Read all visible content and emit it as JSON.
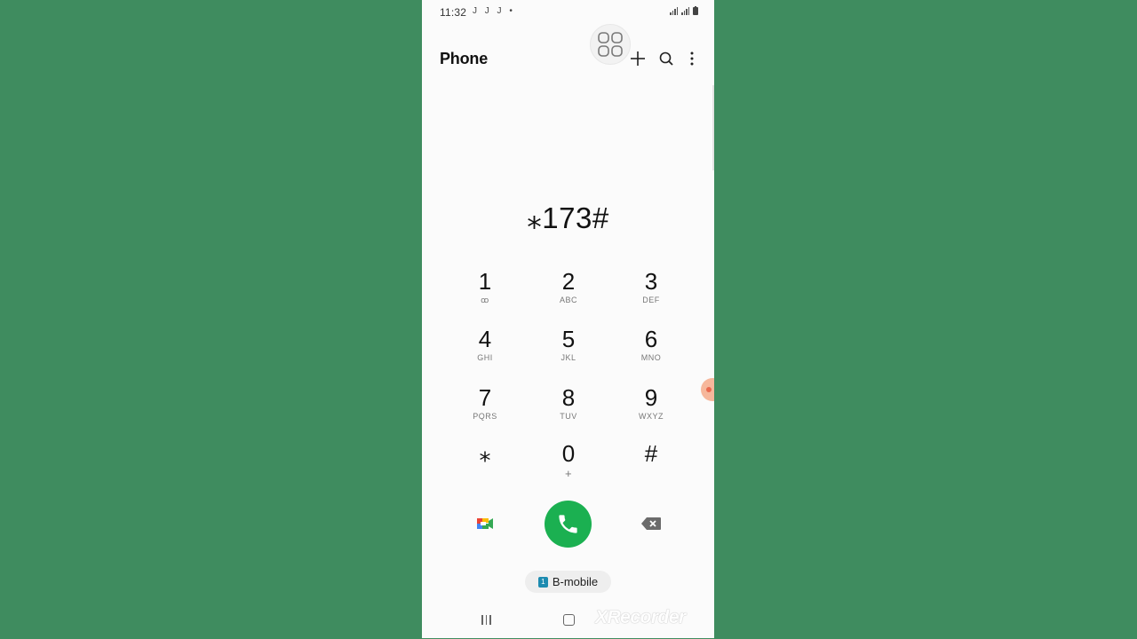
{
  "status_bar": {
    "time": "11:32",
    "notif_icons": "J J J •"
  },
  "header": {
    "title": "Phone",
    "icons": [
      "apps-grid-icon",
      "plus-icon",
      "search-icon",
      "more-vertical-icon"
    ]
  },
  "dialer": {
    "number": "⁎173#",
    "keys": [
      {
        "digit": "1",
        "letters": "ꝏ"
      },
      {
        "digit": "2",
        "letters": "ABC"
      },
      {
        "digit": "3",
        "letters": "DEF"
      },
      {
        "digit": "4",
        "letters": "GHI"
      },
      {
        "digit": "5",
        "letters": "JKL"
      },
      {
        "digit": "6",
        "letters": "MNO"
      },
      {
        "digit": "7",
        "letters": "PQRS"
      },
      {
        "digit": "8",
        "letters": "TUV"
      },
      {
        "digit": "9",
        "letters": "WXYZ"
      },
      {
        "digit": "⁎",
        "letters": ""
      },
      {
        "digit": "0",
        "letters": "+"
      },
      {
        "digit": "#",
        "letters": ""
      }
    ],
    "call_color": "#1bb051"
  },
  "sim": {
    "badge": "1",
    "label": "B-mobile"
  },
  "watermark": "XRecorder",
  "background_color": "#408e60"
}
